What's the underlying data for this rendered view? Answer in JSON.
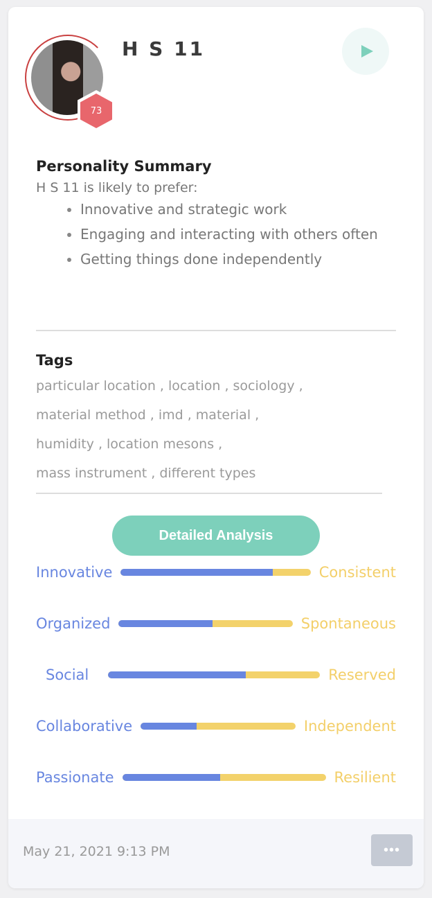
{
  "profile": {
    "name": "H S 11",
    "score": "73",
    "ring_color": "#c94040",
    "badge_color": "#e8666c"
  },
  "summary": {
    "title": "Personality Summary",
    "intro": "H S 11 is likely to prefer:",
    "items": [
      "Innovative and strategic work",
      "Engaging and interacting with others often",
      "Getting things done independently"
    ]
  },
  "tags": {
    "title": "Tags",
    "lines": [
      "particular location , location , sociology ,",
      "material method , imd , material ,",
      "humidity , location mesons ,",
      "mass instrument , different types"
    ]
  },
  "analysis_button": "Detailed Analysis",
  "traits": [
    {
      "left": "Innovative",
      "right": "Consistent",
      "value": 0.8
    },
    {
      "left": "Organized",
      "right": "Spontaneous",
      "value": 0.54
    },
    {
      "left": "Social",
      "right": "Reserved",
      "value": 0.65
    },
    {
      "left": "Collaborative",
      "right": "Independent",
      "value": 0.36
    },
    {
      "left": "Passionate",
      "right": "Resilient",
      "value": 0.48
    }
  ],
  "colors": {
    "accent": "#7dd0bb",
    "left_trait": "#6886e0",
    "right_trait": "#f3cf69"
  },
  "footer": {
    "date": "May 21, 2021 9:13 PM",
    "more_label": "•••"
  },
  "icons": {
    "play": "play-icon",
    "more": "more-horizontal-icon"
  }
}
